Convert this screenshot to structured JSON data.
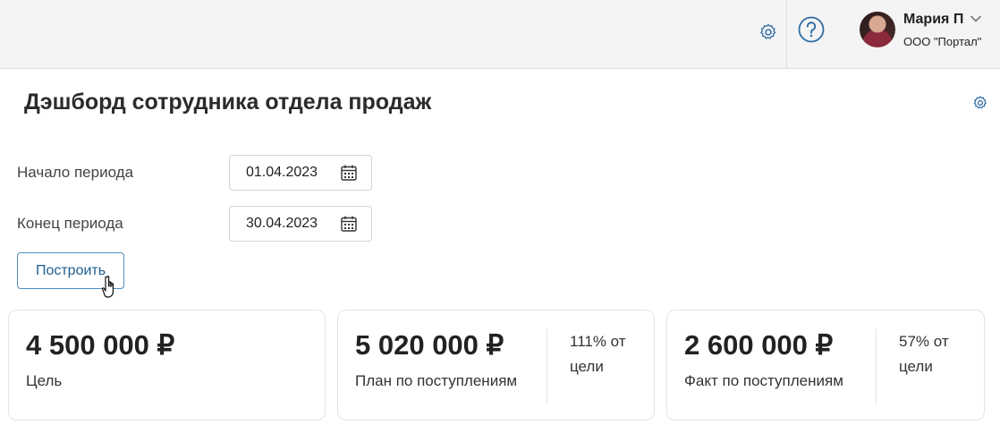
{
  "header": {
    "user": {
      "name": "Мария П",
      "org": "ООО \"Портал\""
    },
    "icons": {
      "settings": "gear-icon",
      "help": "question-circle-icon",
      "user_menu": "chevron-down-icon"
    }
  },
  "page": {
    "title": "Дэшборд сотрудника отдела продаж"
  },
  "filters": {
    "start": {
      "label": "Начало периода",
      "value": "01.04.2023"
    },
    "end": {
      "label": "Конец периода",
      "value": "30.04.2023"
    },
    "build_button": "Построить"
  },
  "cards": [
    {
      "value": "4 500 000 ₽",
      "label": "Цель"
    },
    {
      "value": "5 020 000 ₽",
      "label": "План по поступлениям",
      "percent_line1": "111% от",
      "percent_line2": "цели"
    },
    {
      "value": "2 600 000 ₽",
      "label": "Факт по поступлениям",
      "percent_line1": "57% от",
      "percent_line2": "цели"
    }
  ],
  "colors": {
    "accent": "#1e5f8f",
    "topbar_bg": "#f4f4f4",
    "border": "#e3e3e3"
  }
}
